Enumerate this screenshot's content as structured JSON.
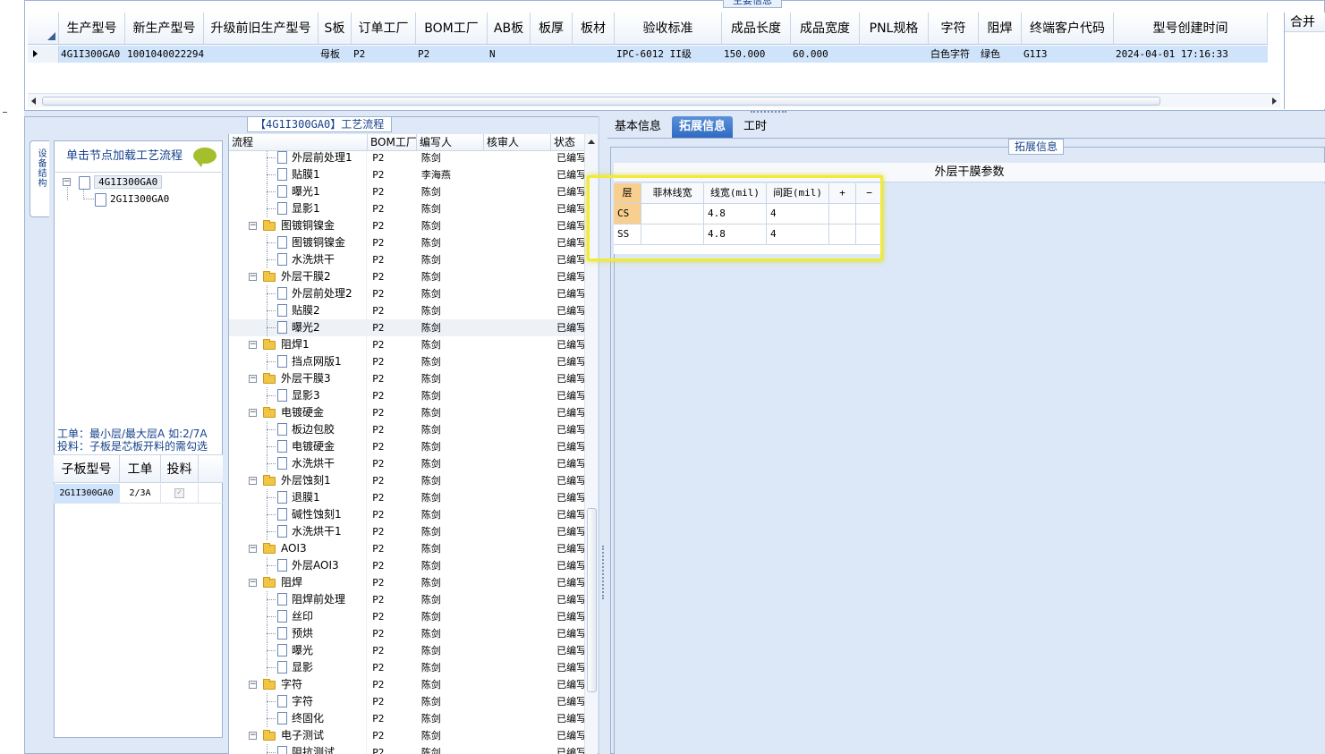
{
  "main_info": {
    "title": "主要信息",
    "columns": [
      "生产型号",
      "新生产型号",
      "升级前旧生产型号",
      "S板",
      "订单工厂",
      "BOM工厂",
      "AB板",
      "板厚",
      "板材",
      "验收标准",
      "成品长度",
      "成品宽度",
      "PNL规格",
      "字符",
      "阻焊",
      "终端客户代码",
      "型号创建时间"
    ],
    "row": [
      "4G1I300GA0",
      "10010400222941",
      "",
      "母板",
      "P2",
      "P2",
      "N",
      "",
      "",
      "IPC-6012 II级",
      "150.000",
      "60.000",
      "",
      "白色字符",
      "绿色",
      "G1I3",
      "2024-04-01 17:16:33"
    ],
    "right_col": "合并"
  },
  "process_panel": {
    "title": "【4G1I300GA0】工艺流程",
    "side_tab": "设备结构",
    "tree_hint": "单击节点加载工艺流程",
    "tree": [
      {
        "label": "4G1I300GA0",
        "expander": "−"
      },
      {
        "label": "2G1I300GA0"
      }
    ],
    "work_order_hint_1": "工单：最小层/最大层A 如:2/7A",
    "work_order_hint_2": "投料：子板是芯板开料的需勾选",
    "sub_board": {
      "columns": [
        "子板型号",
        "工单",
        "投料"
      ],
      "rows": [
        {
          "model": "2G1I300GA0",
          "order": "2/3A",
          "feed": "✓"
        }
      ]
    },
    "grid_columns": [
      "流程",
      "BOM工厂",
      "编写人",
      "核审人",
      "状态"
    ],
    "steps": [
      {
        "name": "外层前处理1",
        "bom": "P2",
        "writer": "陈剑",
        "checker": "",
        "status": "已编写",
        "type": "file"
      },
      {
        "name": "贴膜1",
        "bom": "P2",
        "writer": "李海燕",
        "checker": "",
        "status": "已编写",
        "type": "file"
      },
      {
        "name": "曝光1",
        "bom": "P2",
        "writer": "陈剑",
        "checker": "",
        "status": "已编写",
        "type": "file"
      },
      {
        "name": "显影1",
        "bom": "P2",
        "writer": "陈剑",
        "checker": "",
        "status": "已编写",
        "type": "file"
      },
      {
        "name": "图镀铜镍金",
        "bom": "P2",
        "writer": "陈剑",
        "checker": "",
        "status": "已编写",
        "type": "folder"
      },
      {
        "name": "图镀铜镍金",
        "bom": "P2",
        "writer": "陈剑",
        "checker": "",
        "status": "已编写",
        "type": "file"
      },
      {
        "name": "水洗烘干",
        "bom": "P2",
        "writer": "陈剑",
        "checker": "",
        "status": "已编写",
        "type": "file"
      },
      {
        "name": "外层干膜2",
        "bom": "P2",
        "writer": "陈剑",
        "checker": "",
        "status": "已编写",
        "type": "folder"
      },
      {
        "name": "外层前处理2",
        "bom": "P2",
        "writer": "陈剑",
        "checker": "",
        "status": "已编写",
        "type": "file"
      },
      {
        "name": "贴膜2",
        "bom": "P2",
        "writer": "陈剑",
        "checker": "",
        "status": "已编写",
        "type": "file"
      },
      {
        "name": "曝光2",
        "bom": "P2",
        "writer": "陈剑",
        "checker": "",
        "status": "已编写",
        "type": "file",
        "selected": true
      },
      {
        "name": "阻焊1",
        "bom": "P2",
        "writer": "陈剑",
        "checker": "",
        "status": "已编写",
        "type": "folder"
      },
      {
        "name": "挡点网版1",
        "bom": "P2",
        "writer": "陈剑",
        "checker": "",
        "status": "已编写",
        "type": "file"
      },
      {
        "name": "外层干膜3",
        "bom": "P2",
        "writer": "陈剑",
        "checker": "",
        "status": "已编写",
        "type": "folder"
      },
      {
        "name": "显影3",
        "bom": "P2",
        "writer": "陈剑",
        "checker": "",
        "status": "已编写",
        "type": "file"
      },
      {
        "name": "电镀硬金",
        "bom": "P2",
        "writer": "陈剑",
        "checker": "",
        "status": "已编写",
        "type": "folder"
      },
      {
        "name": "板边包胶",
        "bom": "P2",
        "writer": "陈剑",
        "checker": "",
        "status": "已编写",
        "type": "file"
      },
      {
        "name": "电镀硬金",
        "bom": "P2",
        "writer": "陈剑",
        "checker": "",
        "status": "已编写",
        "type": "file"
      },
      {
        "name": "水洗烘干",
        "bom": "P2",
        "writer": "陈剑",
        "checker": "",
        "status": "已编写",
        "type": "file"
      },
      {
        "name": "外层蚀刻1",
        "bom": "P2",
        "writer": "陈剑",
        "checker": "",
        "status": "已编写",
        "type": "folder"
      },
      {
        "name": "退膜1",
        "bom": "P2",
        "writer": "陈剑",
        "checker": "",
        "status": "已编写",
        "type": "file"
      },
      {
        "name": "碱性蚀刻1",
        "bom": "P2",
        "writer": "陈剑",
        "checker": "",
        "status": "已编写",
        "type": "file"
      },
      {
        "name": "水洗烘干1",
        "bom": "P2",
        "writer": "陈剑",
        "checker": "",
        "status": "已编写",
        "type": "file"
      },
      {
        "name": "AOI3",
        "bom": "P2",
        "writer": "陈剑",
        "checker": "",
        "status": "已编写",
        "type": "folder"
      },
      {
        "name": "外层AOI3",
        "bom": "P2",
        "writer": "陈剑",
        "checker": "",
        "status": "已编写",
        "type": "file"
      },
      {
        "name": "阻焊",
        "bom": "P2",
        "writer": "陈剑",
        "checker": "",
        "status": "已编写",
        "type": "folder"
      },
      {
        "name": "阻焊前处理",
        "bom": "P2",
        "writer": "陈剑",
        "checker": "",
        "status": "已编写",
        "type": "file"
      },
      {
        "name": "丝印",
        "bom": "P2",
        "writer": "陈剑",
        "checker": "",
        "status": "已编写",
        "type": "file"
      },
      {
        "name": "预烘",
        "bom": "P2",
        "writer": "陈剑",
        "checker": "",
        "status": "已编写",
        "type": "file"
      },
      {
        "name": "曝光",
        "bom": "P2",
        "writer": "陈剑",
        "checker": "",
        "status": "已编写",
        "type": "file"
      },
      {
        "name": "显影",
        "bom": "P2",
        "writer": "陈剑",
        "checker": "",
        "status": "已编写",
        "type": "file"
      },
      {
        "name": "字符",
        "bom": "P2",
        "writer": "陈剑",
        "checker": "",
        "status": "已编写",
        "type": "folder"
      },
      {
        "name": "字符",
        "bom": "P2",
        "writer": "陈剑",
        "checker": "",
        "status": "已编写",
        "type": "file"
      },
      {
        "name": "终固化",
        "bom": "P2",
        "writer": "陈剑",
        "checker": "",
        "status": "已编写",
        "type": "file"
      },
      {
        "name": "电子测试",
        "bom": "P2",
        "writer": "陈剑",
        "checker": "",
        "status": "已编写",
        "type": "folder"
      },
      {
        "name": "阻抗测试",
        "bom": "P2",
        "writer": "陈剑",
        "checker": "",
        "status": "已编写",
        "type": "file"
      }
    ]
  },
  "right_panel": {
    "tabs": [
      {
        "label": "基本信息",
        "active": false
      },
      {
        "label": "拓展信息",
        "active": true
      },
      {
        "label": "工时",
        "active": false
      }
    ],
    "ext_title": "拓展信息",
    "param_title": "外层干膜参数",
    "param_columns": [
      "层",
      "菲林线宽",
      "线宽(mil)",
      "间距(mil)",
      "+",
      "−"
    ],
    "param_rows": [
      {
        "layer": "CS",
        "film": "",
        "width": "4.8",
        "space": "4",
        "selected": true
      },
      {
        "layer": "SS",
        "film": "",
        "width": "4.8",
        "space": "4",
        "selected": false
      }
    ]
  },
  "colors": {
    "accent": "#2f6ac2",
    "selection": "#cfe3fb",
    "highlight": "#f0ec36",
    "header_orange": "#f8cf8e"
  }
}
